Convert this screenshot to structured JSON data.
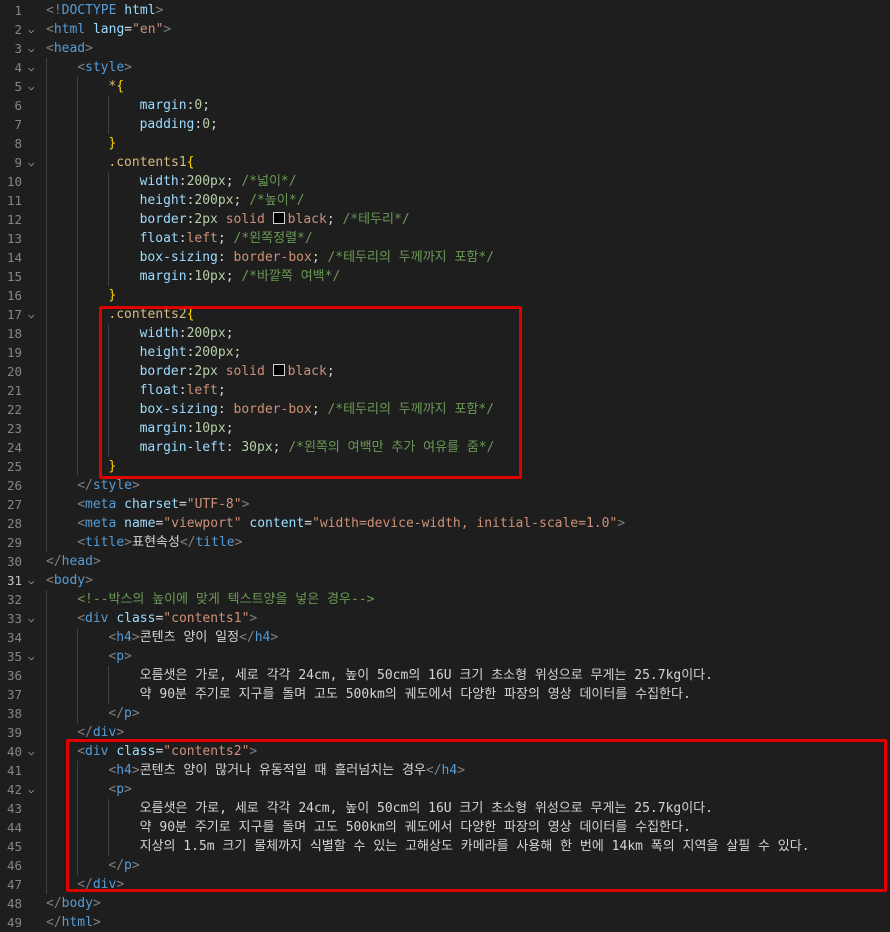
{
  "colors": {
    "highlight": "#e00000",
    "background": "#1e1e1e",
    "swatch": "#000000"
  },
  "lines": [
    {
      "n": "1",
      "fold": false,
      "indent": 0,
      "tokens": [
        [
          "t-br",
          "<!"
        ],
        [
          "t-tag",
          "DOCTYPE"
        ],
        [
          "t-txt",
          " "
        ],
        [
          "t-attr",
          "html"
        ],
        [
          "t-br",
          ">"
        ]
      ]
    },
    {
      "n": "2",
      "fold": true,
      "indent": 0,
      "tokens": [
        [
          "t-br",
          "<"
        ],
        [
          "t-tag",
          "html"
        ],
        [
          "t-txt",
          " "
        ],
        [
          "t-attr",
          "lang"
        ],
        [
          "t-txt",
          "="
        ],
        [
          "t-str",
          "\"en\""
        ],
        [
          "t-br",
          ">"
        ]
      ]
    },
    {
      "n": "3",
      "fold": true,
      "indent": 0,
      "tokens": [
        [
          "t-br",
          "<"
        ],
        [
          "t-tag",
          "head"
        ],
        [
          "t-br",
          ">"
        ]
      ]
    },
    {
      "n": "4",
      "fold": true,
      "indent": 1,
      "tokens": [
        [
          "t-br",
          "<"
        ],
        [
          "t-tag",
          "style"
        ],
        [
          "t-br",
          ">"
        ]
      ]
    },
    {
      "n": "5",
      "fold": true,
      "indent": 2,
      "tokens": [
        [
          "t-sel",
          "*"
        ],
        [
          "t-brace",
          "{"
        ]
      ]
    },
    {
      "n": "6",
      "fold": false,
      "indent": 3,
      "tokens": [
        [
          "t-prop",
          "margin"
        ],
        [
          "t-txt",
          ":"
        ],
        [
          "t-num",
          "0"
        ],
        [
          "t-txt",
          ";"
        ]
      ]
    },
    {
      "n": "7",
      "fold": false,
      "indent": 3,
      "tokens": [
        [
          "t-prop",
          "padding"
        ],
        [
          "t-txt",
          ":"
        ],
        [
          "t-num",
          "0"
        ],
        [
          "t-txt",
          ";"
        ]
      ]
    },
    {
      "n": "8",
      "fold": false,
      "indent": 2,
      "tokens": [
        [
          "t-brace",
          "}"
        ]
      ]
    },
    {
      "n": "9",
      "fold": true,
      "indent": 2,
      "tokens": [
        [
          "t-sel",
          ".contents1"
        ],
        [
          "t-brace",
          "{"
        ]
      ]
    },
    {
      "n": "10",
      "fold": false,
      "indent": 3,
      "tokens": [
        [
          "t-prop",
          "width"
        ],
        [
          "t-txt",
          ":"
        ],
        [
          "t-num",
          "200px"
        ],
        [
          "t-txt",
          "; "
        ],
        [
          "t-com",
          "/*넓이*/"
        ]
      ]
    },
    {
      "n": "11",
      "fold": false,
      "indent": 3,
      "tokens": [
        [
          "t-prop",
          "height"
        ],
        [
          "t-txt",
          ":"
        ],
        [
          "t-num",
          "200px"
        ],
        [
          "t-txt",
          "; "
        ],
        [
          "t-com",
          "/*높이*/"
        ]
      ]
    },
    {
      "n": "12",
      "fold": false,
      "indent": 3,
      "tokens": [
        [
          "t-prop",
          "border"
        ],
        [
          "t-txt",
          ":"
        ],
        [
          "t-num",
          "2px"
        ],
        [
          "t-txt",
          " "
        ],
        [
          "t-val",
          "solid"
        ],
        [
          "t-txt",
          " "
        ],
        [
          "swatch",
          ""
        ],
        [
          "t-val",
          "black"
        ],
        [
          "t-txt",
          "; "
        ],
        [
          "t-com",
          "/*테두리*/"
        ]
      ]
    },
    {
      "n": "13",
      "fold": false,
      "indent": 3,
      "tokens": [
        [
          "t-prop",
          "float"
        ],
        [
          "t-txt",
          ":"
        ],
        [
          "t-val",
          "left"
        ],
        [
          "t-txt",
          "; "
        ],
        [
          "t-com",
          "/*왼쪽정렬*/"
        ]
      ]
    },
    {
      "n": "14",
      "fold": false,
      "indent": 3,
      "tokens": [
        [
          "t-prop",
          "box-sizing"
        ],
        [
          "t-txt",
          ": "
        ],
        [
          "t-val",
          "border-box"
        ],
        [
          "t-txt",
          "; "
        ],
        [
          "t-com",
          "/*테두리의 두께까지 포함*/"
        ]
      ]
    },
    {
      "n": "15",
      "fold": false,
      "indent": 3,
      "tokens": [
        [
          "t-prop",
          "margin"
        ],
        [
          "t-txt",
          ":"
        ],
        [
          "t-num",
          "10px"
        ],
        [
          "t-txt",
          "; "
        ],
        [
          "t-com",
          "/*바깥쪽 여백*/"
        ]
      ]
    },
    {
      "n": "16",
      "fold": false,
      "indent": 2,
      "tokens": [
        [
          "t-brace",
          "}"
        ]
      ]
    },
    {
      "n": "17",
      "fold": true,
      "indent": 2,
      "tokens": [
        [
          "t-sel",
          ".contents2"
        ],
        [
          "t-brace",
          "{"
        ]
      ]
    },
    {
      "n": "18",
      "fold": false,
      "indent": 3,
      "tokens": [
        [
          "t-prop",
          "width"
        ],
        [
          "t-txt",
          ":"
        ],
        [
          "t-num",
          "200px"
        ],
        [
          "t-txt",
          ";"
        ]
      ]
    },
    {
      "n": "19",
      "fold": false,
      "indent": 3,
      "tokens": [
        [
          "t-prop",
          "height"
        ],
        [
          "t-txt",
          ":"
        ],
        [
          "t-num",
          "200px"
        ],
        [
          "t-txt",
          ";"
        ]
      ]
    },
    {
      "n": "20",
      "fold": false,
      "indent": 3,
      "tokens": [
        [
          "t-prop",
          "border"
        ],
        [
          "t-txt",
          ":"
        ],
        [
          "t-num",
          "2px"
        ],
        [
          "t-txt",
          " "
        ],
        [
          "t-val",
          "solid"
        ],
        [
          "t-txt",
          " "
        ],
        [
          "swatch",
          ""
        ],
        [
          "t-val",
          "black"
        ],
        [
          "t-txt",
          ";"
        ]
      ]
    },
    {
      "n": "21",
      "fold": false,
      "indent": 3,
      "tokens": [
        [
          "t-prop",
          "float"
        ],
        [
          "t-txt",
          ":"
        ],
        [
          "t-val",
          "left"
        ],
        [
          "t-txt",
          ";"
        ]
      ]
    },
    {
      "n": "22",
      "fold": false,
      "indent": 3,
      "tokens": [
        [
          "t-prop",
          "box-sizing"
        ],
        [
          "t-txt",
          ": "
        ],
        [
          "t-val",
          "border-box"
        ],
        [
          "t-txt",
          "; "
        ],
        [
          "t-com",
          "/*테두리의 두께까지 포함*/"
        ]
      ]
    },
    {
      "n": "23",
      "fold": false,
      "indent": 3,
      "tokens": [
        [
          "t-prop",
          "margin"
        ],
        [
          "t-txt",
          ":"
        ],
        [
          "t-num",
          "10px"
        ],
        [
          "t-txt",
          ";"
        ]
      ]
    },
    {
      "n": "24",
      "fold": false,
      "indent": 3,
      "tokens": [
        [
          "t-prop",
          "margin-left"
        ],
        [
          "t-txt",
          ": "
        ],
        [
          "t-num",
          "30px"
        ],
        [
          "t-txt",
          "; "
        ],
        [
          "t-com",
          "/*왼쪽의 여백만 추가 여유를 줌*/"
        ]
      ]
    },
    {
      "n": "25",
      "fold": false,
      "indent": 2,
      "tokens": [
        [
          "t-brace",
          "}"
        ]
      ]
    },
    {
      "n": "26",
      "fold": false,
      "indent": 1,
      "tokens": [
        [
          "t-br",
          "</"
        ],
        [
          "t-tag",
          "style"
        ],
        [
          "t-br",
          ">"
        ]
      ]
    },
    {
      "n": "27",
      "fold": false,
      "indent": 1,
      "tokens": [
        [
          "t-br",
          "<"
        ],
        [
          "t-tag",
          "meta"
        ],
        [
          "t-txt",
          " "
        ],
        [
          "t-attr",
          "charset"
        ],
        [
          "t-txt",
          "="
        ],
        [
          "t-str",
          "\"UTF-8\""
        ],
        [
          "t-br",
          ">"
        ]
      ]
    },
    {
      "n": "28",
      "fold": false,
      "indent": 1,
      "tokens": [
        [
          "t-br",
          "<"
        ],
        [
          "t-tag",
          "meta"
        ],
        [
          "t-txt",
          " "
        ],
        [
          "t-attr",
          "name"
        ],
        [
          "t-txt",
          "="
        ],
        [
          "t-str",
          "\"viewport\""
        ],
        [
          "t-txt",
          " "
        ],
        [
          "t-attr",
          "content"
        ],
        [
          "t-txt",
          "="
        ],
        [
          "t-str",
          "\"width=device-width, initial-scale=1.0\""
        ],
        [
          "t-br",
          ">"
        ]
      ]
    },
    {
      "n": "29",
      "fold": false,
      "indent": 1,
      "tokens": [
        [
          "t-br",
          "<"
        ],
        [
          "t-tag",
          "title"
        ],
        [
          "t-br",
          ">"
        ],
        [
          "t-txt",
          "표현속성"
        ],
        [
          "t-br",
          "</"
        ],
        [
          "t-tag",
          "title"
        ],
        [
          "t-br",
          ">"
        ]
      ]
    },
    {
      "n": "30",
      "fold": false,
      "indent": 0,
      "tokens": [
        [
          "t-br",
          "</"
        ],
        [
          "t-tag",
          "head"
        ],
        [
          "t-br",
          ">"
        ]
      ]
    },
    {
      "n": "31",
      "fold": true,
      "indent": 0,
      "current": true,
      "tokens": [
        [
          "t-br",
          "<"
        ],
        [
          "t-tag",
          "body"
        ],
        [
          "t-br",
          ">"
        ]
      ]
    },
    {
      "n": "32",
      "fold": false,
      "indent": 1,
      "tokens": [
        [
          "t-com",
          "<!--박스의 높이에 맞게 텍스트양을 넣은 경우-->"
        ]
      ]
    },
    {
      "n": "33",
      "fold": true,
      "indent": 1,
      "tokens": [
        [
          "t-br",
          "<"
        ],
        [
          "t-tag",
          "div"
        ],
        [
          "t-txt",
          " "
        ],
        [
          "t-attr",
          "class"
        ],
        [
          "t-txt",
          "="
        ],
        [
          "t-str",
          "\"contents1\""
        ],
        [
          "t-br",
          ">"
        ]
      ]
    },
    {
      "n": "34",
      "fold": false,
      "indent": 2,
      "tokens": [
        [
          "t-br",
          "<"
        ],
        [
          "t-tag",
          "h4"
        ],
        [
          "t-br",
          ">"
        ],
        [
          "t-txt",
          "콘텐츠 양이 일정"
        ],
        [
          "t-br",
          "</"
        ],
        [
          "t-tag",
          "h4"
        ],
        [
          "t-br",
          ">"
        ]
      ]
    },
    {
      "n": "35",
      "fold": true,
      "indent": 2,
      "tokens": [
        [
          "t-br",
          "<"
        ],
        [
          "t-tag",
          "p"
        ],
        [
          "t-br",
          ">"
        ]
      ]
    },
    {
      "n": "36",
      "fold": false,
      "indent": 3,
      "tokens": [
        [
          "t-txt",
          "오름샛은 가로, 세로 각각 24cm, 높이 50cm의 16U 크기 초소형 위성으로 무게는 25.7kg이다."
        ]
      ]
    },
    {
      "n": "37",
      "fold": false,
      "indent": 3,
      "tokens": [
        [
          "t-txt",
          "약 90분 주기로 지구를 돌며 고도 500km의 궤도에서 다양한 파장의 영상 데이터를 수집한다."
        ]
      ]
    },
    {
      "n": "38",
      "fold": false,
      "indent": 2,
      "tokens": [
        [
          "t-br",
          "</"
        ],
        [
          "t-tag",
          "p"
        ],
        [
          "t-br",
          ">"
        ]
      ]
    },
    {
      "n": "39",
      "fold": false,
      "indent": 1,
      "tokens": [
        [
          "t-br",
          "</"
        ],
        [
          "t-tag",
          "div"
        ],
        [
          "t-br",
          ">"
        ]
      ]
    },
    {
      "n": "40",
      "fold": true,
      "indent": 1,
      "tokens": [
        [
          "t-br",
          "<"
        ],
        [
          "t-tag",
          "div"
        ],
        [
          "t-txt",
          " "
        ],
        [
          "t-attr",
          "class"
        ],
        [
          "t-txt",
          "="
        ],
        [
          "t-str",
          "\"contents2\""
        ],
        [
          "t-br",
          ">"
        ]
      ]
    },
    {
      "n": "41",
      "fold": false,
      "indent": 2,
      "tokens": [
        [
          "t-br",
          "<"
        ],
        [
          "t-tag",
          "h4"
        ],
        [
          "t-br",
          ">"
        ],
        [
          "t-txt",
          "콘텐츠 양이 많거나 유동적일 때 흘러넘치는 경우"
        ],
        [
          "t-br",
          "</"
        ],
        [
          "t-tag",
          "h4"
        ],
        [
          "t-br",
          ">"
        ]
      ]
    },
    {
      "n": "42",
      "fold": true,
      "indent": 2,
      "tokens": [
        [
          "t-br",
          "<"
        ],
        [
          "t-tag",
          "p"
        ],
        [
          "t-br",
          ">"
        ]
      ]
    },
    {
      "n": "43",
      "fold": false,
      "indent": 3,
      "tokens": [
        [
          "t-txt",
          "오름샛은 가로, 세로 각각 24cm, 높이 50cm의 16U 크기 초소형 위성으로 무게는 25.7kg이다."
        ]
      ]
    },
    {
      "n": "44",
      "fold": false,
      "indent": 3,
      "tokens": [
        [
          "t-txt",
          "약 90분 주기로 지구를 돌며 고도 500km의 궤도에서 다양한 파장의 영상 데이터를 수집한다."
        ]
      ]
    },
    {
      "n": "45",
      "fold": false,
      "indent": 3,
      "tokens": [
        [
          "t-txt",
          "지상의 1.5m 크기 물체까지 식별할 수 있는 고해상도 카메라를 사용해 한 번에 14km 폭의 지역을 살필 수 있다."
        ]
      ]
    },
    {
      "n": "46",
      "fold": false,
      "indent": 2,
      "tokens": [
        [
          "t-br",
          "</"
        ],
        [
          "t-tag",
          "p"
        ],
        [
          "t-br",
          ">"
        ]
      ]
    },
    {
      "n": "47",
      "fold": false,
      "indent": 1,
      "tokens": [
        [
          "t-br",
          "</"
        ],
        [
          "t-tag",
          "div"
        ],
        [
          "t-br",
          ">"
        ]
      ]
    },
    {
      "n": "48",
      "fold": false,
      "indent": 0,
      "tokens": [
        [
          "t-br",
          "</"
        ],
        [
          "t-tag",
          "body"
        ],
        [
          "t-br",
          ">"
        ]
      ]
    },
    {
      "n": "49",
      "fold": false,
      "indent": 0,
      "tokens": [
        [
          "t-br",
          "</"
        ],
        [
          "t-tag",
          "html"
        ],
        [
          "t-br",
          ">"
        ]
      ]
    }
  ],
  "fold_icon": "chevron-down-icon",
  "fold_glyph": "⌵"
}
